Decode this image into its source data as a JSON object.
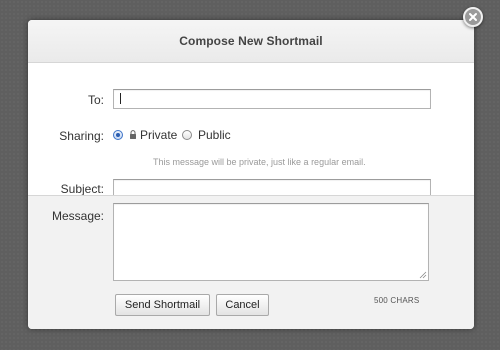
{
  "dialog": {
    "title": "Compose New Shortmail"
  },
  "form": {
    "to": {
      "label": "To:",
      "value": ""
    },
    "sharing": {
      "label": "Sharing:",
      "options": [
        {
          "label": "Private",
          "selected": true,
          "icon": "lock-icon"
        },
        {
          "label": "Public",
          "selected": false
        }
      ],
      "hint": "This message will be private, just like a regular email."
    },
    "subject": {
      "label": "Subject:",
      "value": ""
    },
    "message": {
      "label": "Message:",
      "value": ""
    }
  },
  "actions": {
    "send_label": "Send Shortmail",
    "cancel_label": "Cancel",
    "char_count": "500 CHARS"
  },
  "icons": {
    "close": "close-icon",
    "lock": "lock-icon",
    "resize": "resize-grip-icon"
  },
  "colors": {
    "overlay": "#5f5f5f",
    "radio_selected": "#2a5db0",
    "hint_text": "#9a9a9a"
  }
}
